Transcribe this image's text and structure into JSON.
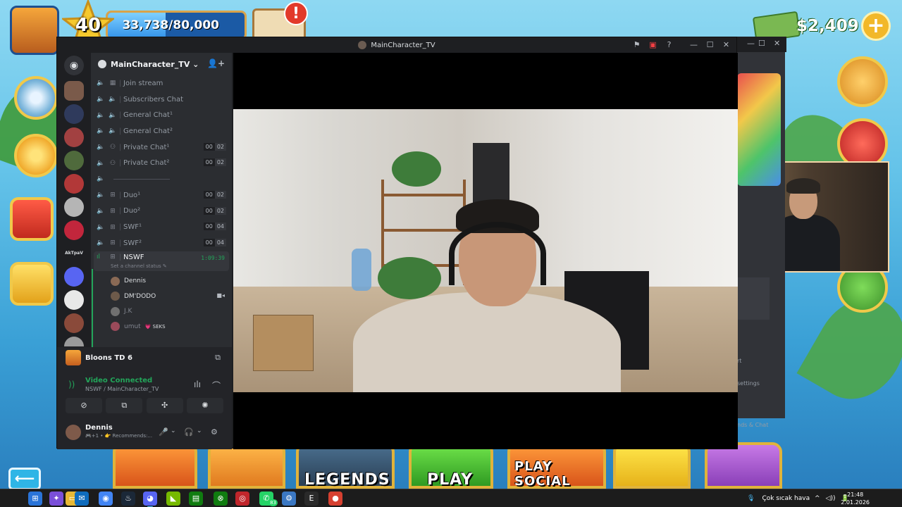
{
  "game": {
    "level": "40",
    "xp_text": "33,738/80,000",
    "xp_progress": 0.4217,
    "mail_alert": "!",
    "cash": "$2,409",
    "cash_add": "+",
    "bottom_buttons": [
      {
        "label": "LEGENDS"
      },
      {
        "label": "PLAY"
      },
      {
        "label": "PLAY SOCIAL"
      }
    ],
    "back": "⟵"
  },
  "window": {
    "title": "MainCharacter_TV",
    "icons": [
      "flag-icon",
      "screen-icon",
      "help-icon",
      "minimize-icon",
      "maximize-icon",
      "close-icon"
    ],
    "icon_glyphs": [
      "⚑",
      "▣",
      "?",
      "—",
      "☐",
      "✕"
    ]
  },
  "server": {
    "name": "MainCharacter_TV ⌄",
    "add_user": "👤+"
  },
  "guild_labels": {
    "home": "◉",
    "akt": "AkTpaV"
  },
  "channels": [
    {
      "icon": "stage",
      "glyph": "▦",
      "name": "Join stream"
    },
    {
      "icon": "speaker",
      "glyph": "🔈",
      "name": "Subscribers Chat"
    },
    {
      "icon": "speaker",
      "glyph": "🔈",
      "name": "General Chat¹"
    },
    {
      "icon": "speaker",
      "glyph": "🔈",
      "name": "General Chat²"
    },
    {
      "icon": "users",
      "glyph": "⚇",
      "name": "Private Chat¹",
      "count_a": "00",
      "count_b": "02"
    },
    {
      "icon": "users",
      "glyph": "⚇",
      "name": "Private Chat²",
      "count_a": "00",
      "count_b": "02"
    },
    {
      "icon": "divider",
      "glyph": "",
      "name": ""
    },
    {
      "icon": "gamepad",
      "glyph": "⊞",
      "name": "Duo¹",
      "count_a": "00",
      "count_b": "02"
    },
    {
      "icon": "gamepad",
      "glyph": "⊞",
      "name": "Duo²",
      "count_a": "00",
      "count_b": "02"
    },
    {
      "icon": "gamepad",
      "glyph": "⊞",
      "name": "SWF¹",
      "count_a": "00",
      "count_b": "04"
    },
    {
      "icon": "gamepad",
      "glyph": "⊞",
      "name": "SWF²",
      "count_a": "00",
      "count_b": "04"
    }
  ],
  "selected_channel": {
    "name": "NSWF",
    "timer": "1:09:39",
    "status": "Set a channel status ✎"
  },
  "voice_users": [
    {
      "name": "Dennis",
      "badge": "",
      "color": "#8a6a55",
      "dim": false,
      "camera": false
    },
    {
      "name": "DM'DODO",
      "badge": "",
      "color": "#6d5a4a",
      "dim": false,
      "camera": true
    },
    {
      "name": "J.K",
      "badge": "",
      "color": "#707070",
      "dim": true,
      "camera": false
    },
    {
      "name": "umut",
      "badge": "💗 SEKS",
      "color": "#9a4a5a",
      "dim": true,
      "camera": false
    }
  ],
  "activity": {
    "game": "Bloons TD 6"
  },
  "voice": {
    "status": "Video Connected",
    "location": "NSWF / MainCharacter_TV"
  },
  "voice_buttons": [
    "⊘",
    "⧉",
    "✣",
    "✺"
  ],
  "user": {
    "name": "Dennis",
    "status": "🎮+1 • 👉 Recommends:..."
  },
  "user_controls": [
    "🎤",
    "⌄",
    "🎧",
    "⌄",
    "⚙"
  ],
  "behind_window": {
    "glyphs": [
      "—",
      "☐",
      "✕"
    ],
    "text_1": "rt",
    "text_2": "settings",
    "text_3": "nds & Chat"
  },
  "taskbar": {
    "apps": [
      {
        "name": "windows-start-icon",
        "glyph": "⊞",
        "bg": "#2a74d8"
      },
      {
        "name": "copilot-icon",
        "glyph": "✦",
        "bg": "#7a4fd9"
      },
      {
        "name": "file-explorer-icon",
        "glyph": "▭",
        "bg": "#e8b935"
      },
      {
        "name": "outlook-icon",
        "glyph": "✉",
        "bg": "#0f6cbd"
      },
      {
        "name": "chrome-icon",
        "glyph": "◉",
        "bg": "#4285f4"
      },
      {
        "name": "steam-icon",
        "glyph": "♨",
        "bg": "#1b2838"
      },
      {
        "name": "discord-taskbar-icon",
        "glyph": "◕",
        "bg": "#5865f2"
      },
      {
        "name": "nvidia-icon",
        "glyph": "◣",
        "bg": "#76b900"
      },
      {
        "name": "app-green-icon",
        "glyph": "▤",
        "bg": "#107c10"
      },
      {
        "name": "xbox-icon",
        "glyph": "⊗",
        "bg": "#107c10"
      },
      {
        "name": "opera-icon",
        "glyph": "◎",
        "bg": "#c0262b"
      },
      {
        "name": "whatsapp-icon",
        "glyph": "✆",
        "bg": "#25d366",
        "badge": "83"
      },
      {
        "name": "settings-app-icon",
        "glyph": "⚙",
        "bg": "#3b78c3"
      },
      {
        "name": "epic-games-icon",
        "glyph": "E",
        "bg": "#2a2a2a"
      },
      {
        "name": "bloons-app-icon",
        "glyph": "●",
        "bg": "#d64030"
      }
    ],
    "weather": "Çok sıcak hava",
    "time": "21:48",
    "date": "2.01.2026",
    "tray": [
      "^",
      "◁))",
      "🔋"
    ]
  },
  "colors": {
    "discord_bg": "#1e1f22",
    "channel_bg": "#2b2d31",
    "green": "#23a55a",
    "xp_bar": "#1b5aa5",
    "gold": "#f0c94a"
  }
}
